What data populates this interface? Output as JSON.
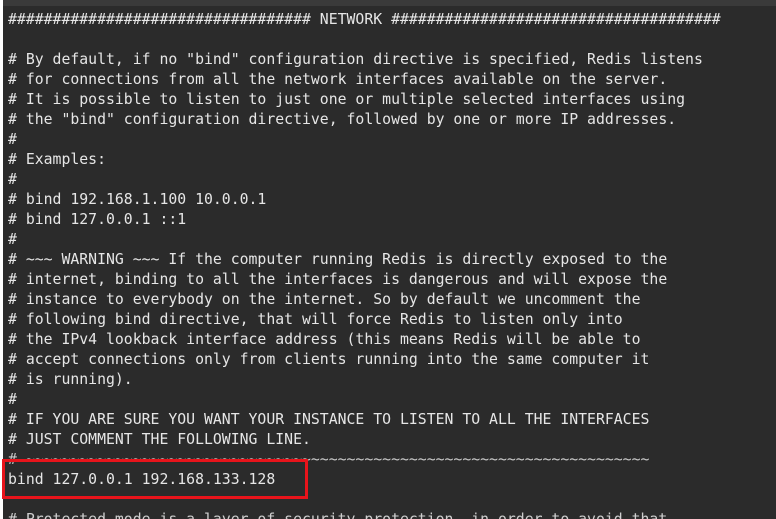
{
  "editor": {
    "lines": [
      "################################## NETWORK #####################################",
      "",
      "# By default, if no \"bind\" configuration directive is specified, Redis listens",
      "# for connections from all the network interfaces available on the server.",
      "# It is possible to listen to just one or multiple selected interfaces using",
      "# the \"bind\" configuration directive, followed by one or more IP addresses.",
      "#",
      "# Examples:",
      "#",
      "# bind 192.168.1.100 10.0.0.1",
      "# bind 127.0.0.1 ::1",
      "#",
      "# ~~~ WARNING ~~~ If the computer running Redis is directly exposed to the",
      "# internet, binding to all the interfaces is dangerous and will expose the",
      "# instance to everybody on the internet. So by default we uncomment the",
      "# following bind directive, that will force Redis to listen only into",
      "# the IPv4 lookback interface address (this means Redis will be able to",
      "# accept connections only from clients running into the same computer it",
      "# is running).",
      "#",
      "# IF YOU ARE SURE YOU WANT YOUR INSTANCE TO LISTEN TO ALL THE INTERFACES",
      "# JUST COMMENT THE FOLLOWING LINE.",
      "# ~~~~~~~~~~~~~~~~~~~~~~~~~~~~~~~~~~~~~~~~~~~~~~~~~~~~~~~~~~~~~~~~~~~~~~",
      "bind 127.0.0.1 192.168.133.128",
      "",
      "# Protected mode is a layer of security protection, in order to avoid that"
    ],
    "colors": {
      "background": "#2b2b2b",
      "text": "#e6e6e6",
      "highlight": "#e8141b"
    }
  }
}
